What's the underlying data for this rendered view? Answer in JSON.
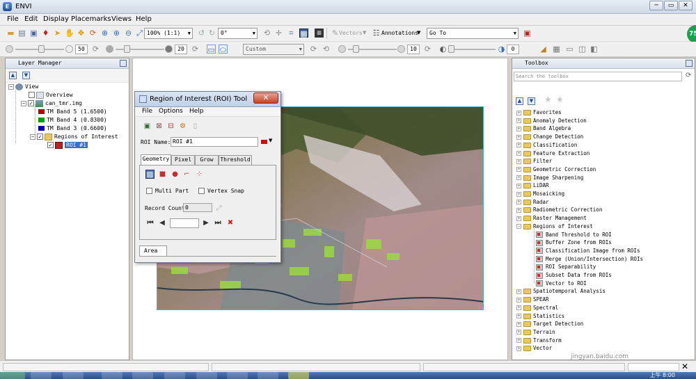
{
  "app": {
    "title": "ENVI",
    "logo_text": "E"
  },
  "window_buttons": {
    "minimize": "─",
    "restore": "▭",
    "close": "✕"
  },
  "menubar": [
    "File",
    "Edit",
    "Display",
    "Placemarks",
    "Views",
    "Help"
  ],
  "toolbar1": {
    "zoom": "100% (1:1)",
    "rotation": "0°",
    "vectors": "Vectors",
    "annotations": "Annotations",
    "goto": "Go To",
    "badge": "75"
  },
  "toolbar2": {
    "brightness": "50",
    "contrast": "20",
    "stretch": "Custom",
    "sharpen": "10",
    "transparency": "0"
  },
  "layer_manager": {
    "title": "Layer Manager",
    "tree": {
      "view": "View",
      "overview": "Overview",
      "file": "can_tmr.img",
      "bands": [
        {
          "label": "TM Band 5 (1.6500)",
          "color": "#c00000"
        },
        {
          "label": "TM Band 4 (0.8300)",
          "color": "#00a000"
        },
        {
          "label": "TM Band 3 (0.6600)",
          "color": "#0000b0"
        }
      ],
      "regions": "Regions of Interest",
      "roi": "ROI #1"
    }
  },
  "roi_dialog": {
    "title": "Region of Interest (ROI) Tool",
    "close": "✕",
    "menu": [
      "File",
      "Options",
      "Help"
    ],
    "roi_name_label": "ROI Name:",
    "roi_name_value": "ROI #1",
    "roi_color": "#e00000",
    "tabs": [
      "Geometry",
      "Pixel",
      "Grow",
      "Threshold"
    ],
    "multi_part": "Multi Part",
    "vertex_snap": "Vertex Snap",
    "record_count_label": "Record Count",
    "record_count_value": "0",
    "bottom_tab": "Area"
  },
  "toolbox": {
    "title": "Toolbox",
    "search_placeholder": "Search the toolbox",
    "items": [
      "Favorites",
      "Anomaly Detection",
      "Band Algebra",
      "Change Detection",
      "Classification",
      "Feature Extraction",
      "Filter",
      "Geometric Correction",
      "Image Sharpening",
      "LiDAR",
      "Mosaicking",
      "Radar",
      "Radiometric Correction",
      "Raster Management",
      "Regions of Interest"
    ],
    "roi_tools": [
      "Band Threshold to ROI",
      "Buffer Zone from ROIs",
      "Classification Image from ROIs",
      "Merge (Union/Intersection) ROIs",
      "ROI Separability",
      "Subset Data from ROIs",
      "Vector to ROI"
    ],
    "items_after": [
      "Spatiotemporal Analysis",
      "SPEAR",
      "Spectral",
      "Statistics",
      "Target Detection",
      "Terrain",
      "Transform",
      "Vector"
    ]
  },
  "taskbar": {
    "clock": "上午 8:00"
  },
  "watermark": {
    "text": "Bai 经验",
    "url": "jingyan.baidu.com"
  }
}
